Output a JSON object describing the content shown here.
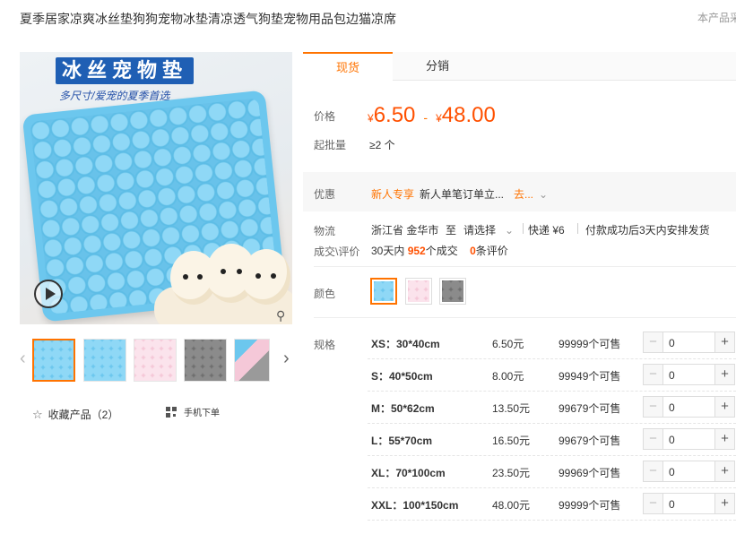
{
  "product": {
    "title": "夏季居家凉爽冰丝垫狗狗宠物冰垫清凉透气狗垫宠物用品包边猫凉席",
    "report_text": "本产品采",
    "image": {
      "banner_text": "冰丝宠物垫",
      "banner_sub": "多尺寸/爱宠的夏季首选"
    },
    "thumbnails": [
      "blue-mat",
      "blue-mat",
      "pink-mat",
      "grey-mat",
      "stacked-mats"
    ],
    "favorite_label": "收藏产品（2）",
    "mobile_order_label": "手机下单"
  },
  "tabs": [
    "现货",
    "分销"
  ],
  "pricing": {
    "label": "价格",
    "yen": "¥",
    "low": "6.50",
    "high": "48.00",
    "dash": "-",
    "moq_label": "起批量",
    "moq_value": "≥2 个"
  },
  "promo": {
    "label": "优惠",
    "tag": "新人专享",
    "text": "新人单笔订单立...",
    "more": "去..."
  },
  "shipping": {
    "label": "物流",
    "origin": "浙江省 金华市",
    "to": "至",
    "destination": "请选择",
    "express": "快递 ¥6",
    "dispatch": "付款成功后3天内安排发货"
  },
  "deals": {
    "label": "成交\\评价",
    "prefix": "30天内",
    "count": "952",
    "count_suffix": "个成交",
    "reviews": "0",
    "reviews_suffix": "条评价"
  },
  "color": {
    "label": "颜色",
    "options": [
      {
        "name": "blue",
        "hex": "#6cc7ee"
      },
      {
        "name": "pink",
        "hex": "#f5c8d8"
      },
      {
        "name": "grey",
        "hex": "#6f6f6f"
      }
    ]
  },
  "sku": {
    "label": "规格",
    "rows": [
      {
        "name": "XS：30*40cm",
        "price": "6.50元",
        "stock": "99999个可售",
        "qty": "0"
      },
      {
        "name": "S：40*50cm",
        "price": "8.00元",
        "stock": "99949个可售",
        "qty": "0"
      },
      {
        "name": "M：50*62cm",
        "price": "13.50元",
        "stock": "99679个可售",
        "qty": "0"
      },
      {
        "name": "L：55*70cm",
        "price": "16.50元",
        "stock": "99679个可售",
        "qty": "0"
      },
      {
        "name": "XL：70*100cm",
        "price": "23.50元",
        "stock": "99969个可售",
        "qty": "0"
      },
      {
        "name": "XXL：100*150cm",
        "price": "48.00元",
        "stock": "99999个可售",
        "qty": "0"
      }
    ],
    "minus": "−",
    "plus": "+"
  },
  "colors": {
    "accent": "#ff7300",
    "price": "#ff5000"
  }
}
